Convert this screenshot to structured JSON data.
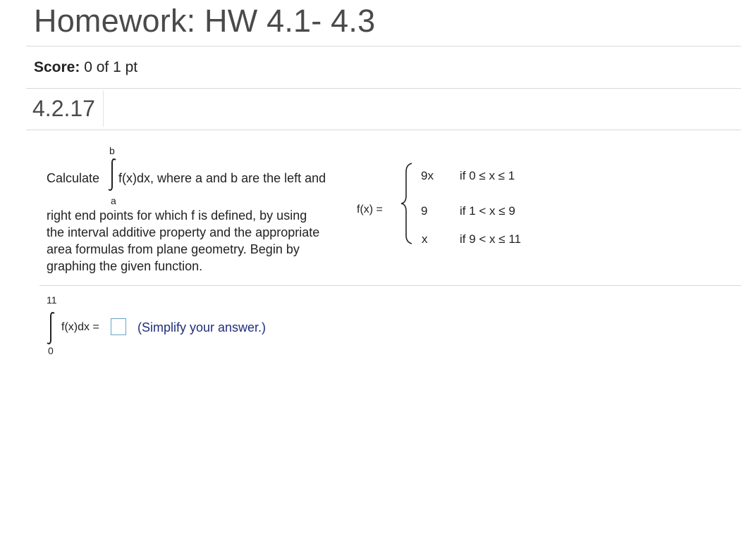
{
  "header": {
    "title": "Homework: HW 4.1- 4.3"
  },
  "score": {
    "label": "Score:",
    "value": "0 of 1 pt"
  },
  "question": {
    "number": "4.2.17",
    "prompt": {
      "calculate": "Calculate",
      "upper_limit": "b",
      "lower_limit": "a",
      "integrand_tail": "f(x)dx, where a and b are the left and",
      "lines": [
        "right end points for which f is defined, by using",
        "the interval additive property and the appropriate",
        "area formulas from plane geometry.  Begin by",
        "graphing the given function."
      ]
    },
    "function": {
      "lhs": "f(x) =",
      "pieces": [
        {
          "expr": "9x",
          "cond": "if 0 ≤ x ≤ 1"
        },
        {
          "expr": "9",
          "cond": "if 1 < x ≤ 9"
        },
        {
          "expr": "x",
          "cond": "if 9 < x ≤ 11"
        }
      ]
    },
    "answer": {
      "upper_limit": "11",
      "lower_limit": "0",
      "integrand": "f(x)dx =",
      "value": "",
      "hint": "(Simplify your answer.)"
    }
  }
}
